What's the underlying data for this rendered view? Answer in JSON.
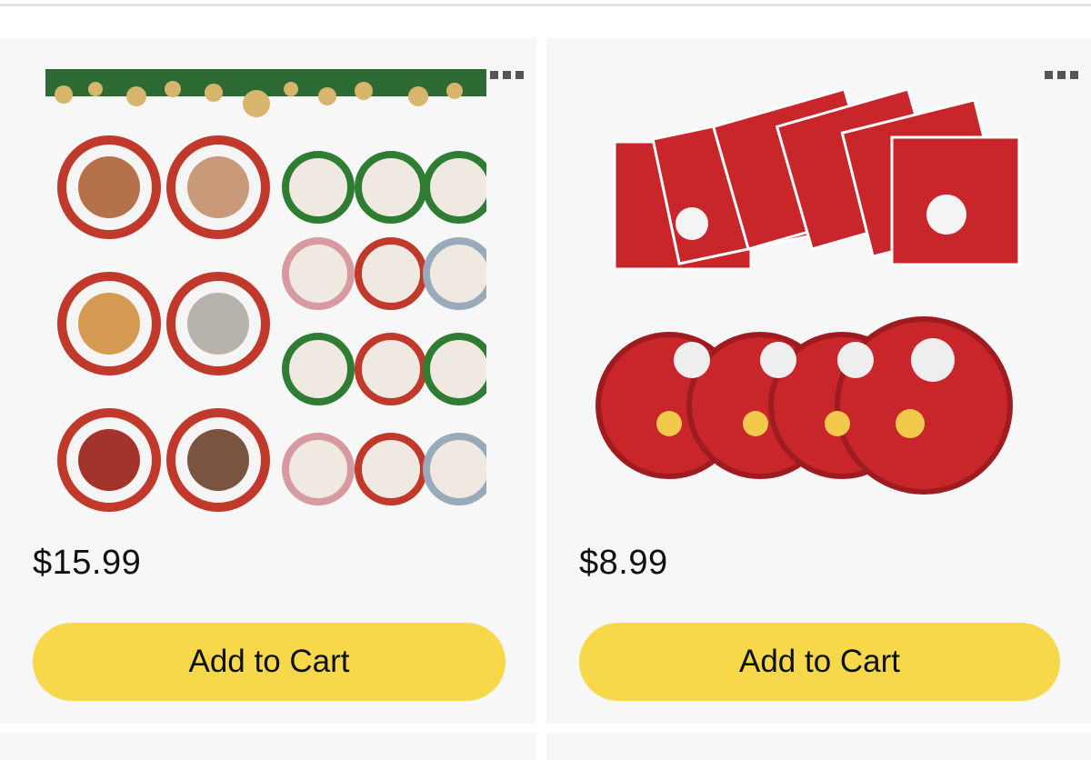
{
  "products": [
    {
      "image_icon": "photo-ornament-set-image",
      "price": "$15.99",
      "cta_label": "Add to Cart"
    },
    {
      "image_icon": "christmas-napkins-plates-image",
      "price": "$8.99",
      "cta_label": "Add to Cart"
    }
  ],
  "colors": {
    "button": "#f7d84a",
    "card_bg": "#f7f7f8",
    "text": "#0f1111",
    "plate_red": "#c8262b"
  },
  "more_icon": "more-options-icon"
}
